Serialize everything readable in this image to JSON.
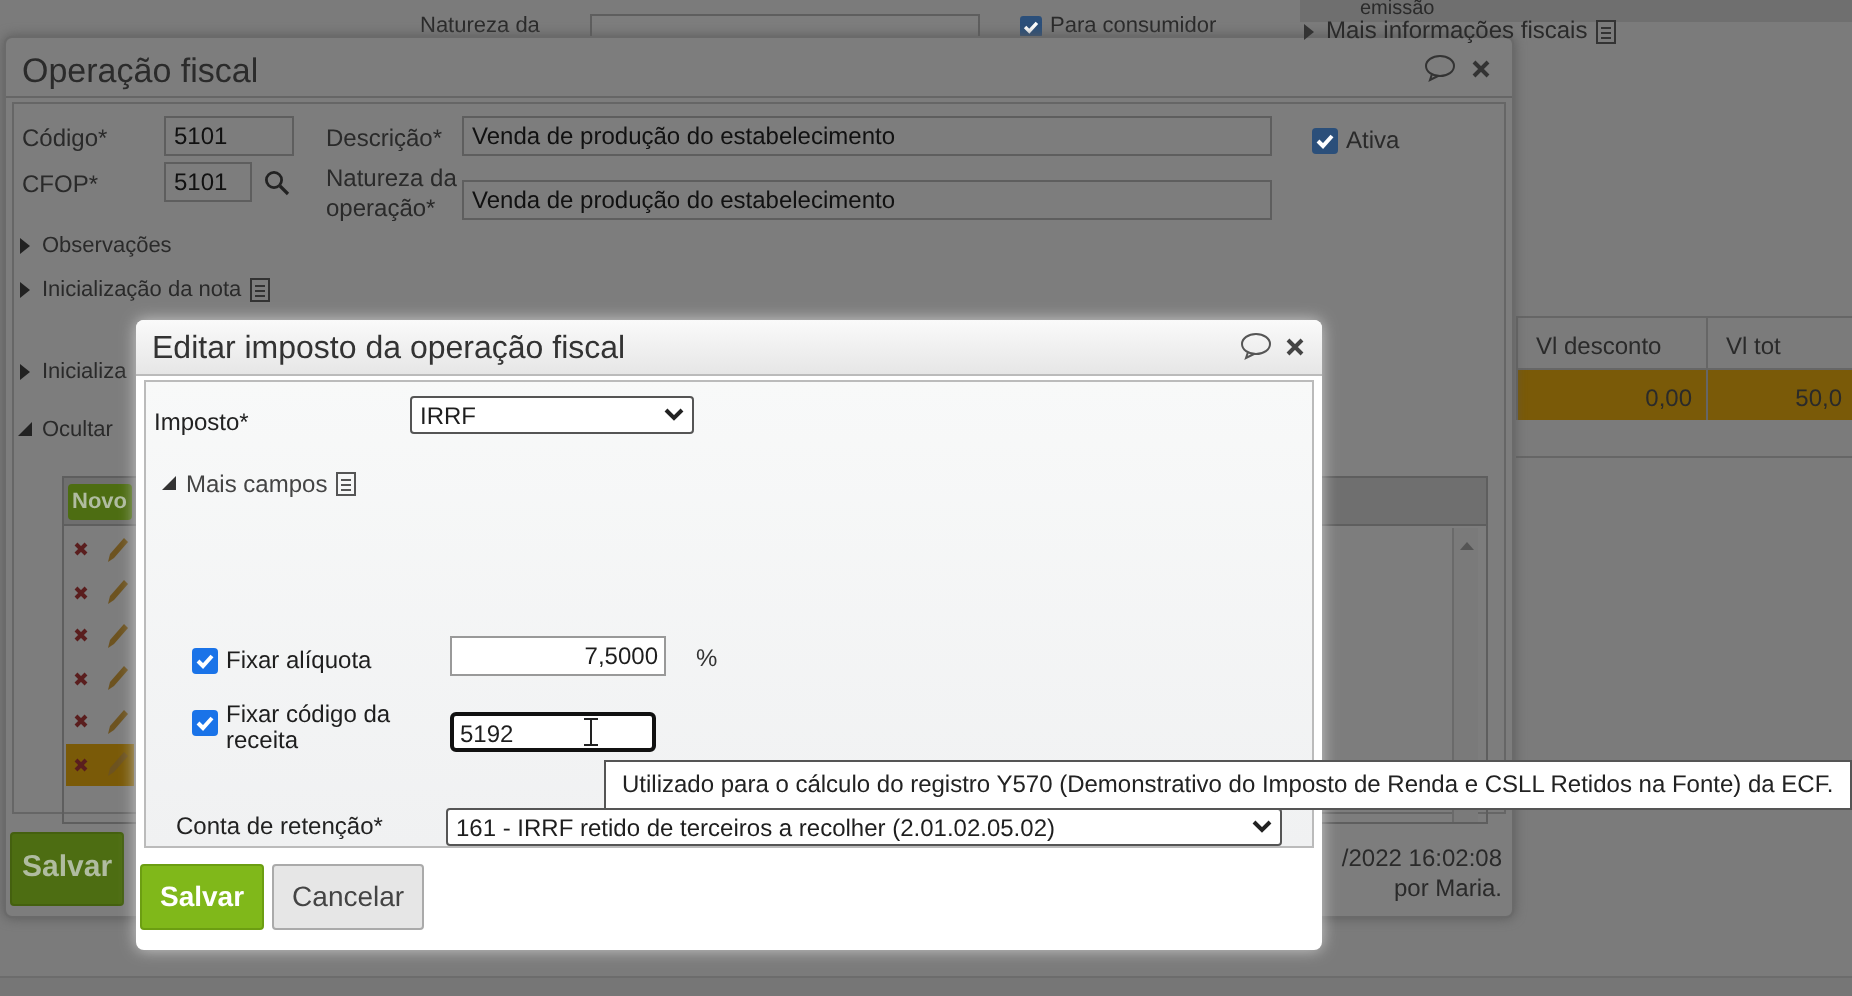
{
  "background_page": {
    "fields": [
      {
        "label": "Natureza da"
      },
      {
        "label": "emissão"
      }
    ],
    "para_consumidor": {
      "label": "Para consumidor",
      "checked": true
    },
    "mais_informacoes": {
      "label": "Mais informações fiscais",
      "expanded": false
    },
    "table": {
      "columns": [
        "Vl desconto",
        "Vl tot"
      ],
      "rows": [
        {
          "cells": [
            "0,00",
            "50,0"
          ],
          "selected": true
        }
      ]
    }
  },
  "operacao_fiscal": {
    "title": "Operação fiscal",
    "codigo": {
      "label": "Código*",
      "value": "5101"
    },
    "descricao": {
      "label": "Descrição*",
      "value": "Venda de produção do estabelecimento"
    },
    "ativa": {
      "label": "Ativa",
      "checked": true
    },
    "cfop": {
      "label": "CFOP*",
      "value": "5101"
    },
    "natureza": {
      "label": "Natureza da operação*",
      "value": "Venda de produção do estabelecimento"
    },
    "sections": [
      {
        "label": "Observações",
        "expanded": false,
        "note": false
      },
      {
        "label": "Inicialização da nota",
        "expanded": false,
        "note": true
      },
      {
        "label": "Inicializa",
        "expanded": false,
        "note": false
      },
      {
        "label": "Ocultar",
        "expanded": true,
        "note": false
      }
    ],
    "tax_table": {
      "new_button": "Novo",
      "rows": [
        {
          "selected": false
        },
        {
          "selected": false
        },
        {
          "selected": false
        },
        {
          "selected": false
        },
        {
          "selected": false
        },
        {
          "selected": true
        }
      ]
    },
    "save_button": "Salvar",
    "audit": [
      "/2022 16:02:08",
      "por Maria."
    ]
  },
  "editar_imposto": {
    "title": "Editar imposto da operação fiscal",
    "imposto": {
      "label": "Imposto*",
      "value": "IRRF"
    },
    "mais_campos": {
      "label": "Mais campos",
      "expanded": true
    },
    "fixar_aliquota": {
      "label": "Fixar alíquota",
      "checked": true,
      "value": "7,5000",
      "unit": "%"
    },
    "fixar_codigo": {
      "label": "Fixar código da receita",
      "checked": true,
      "value": "5192"
    },
    "tooltip": "Utilizado para o cálculo do registro Y570 (Demonstrativo do Imposto de Renda e CSLL Retidos na Fonte) da ECF.",
    "conta_retencao": {
      "label": "Conta de retenção*",
      "value": "161 - IRRF retido de terceiros a recolher (2.01.02.05.02)"
    },
    "buttons": [
      {
        "label": "Salvar",
        "kind": "primary"
      },
      {
        "label": "Cancelar",
        "kind": "secondary"
      }
    ]
  }
}
